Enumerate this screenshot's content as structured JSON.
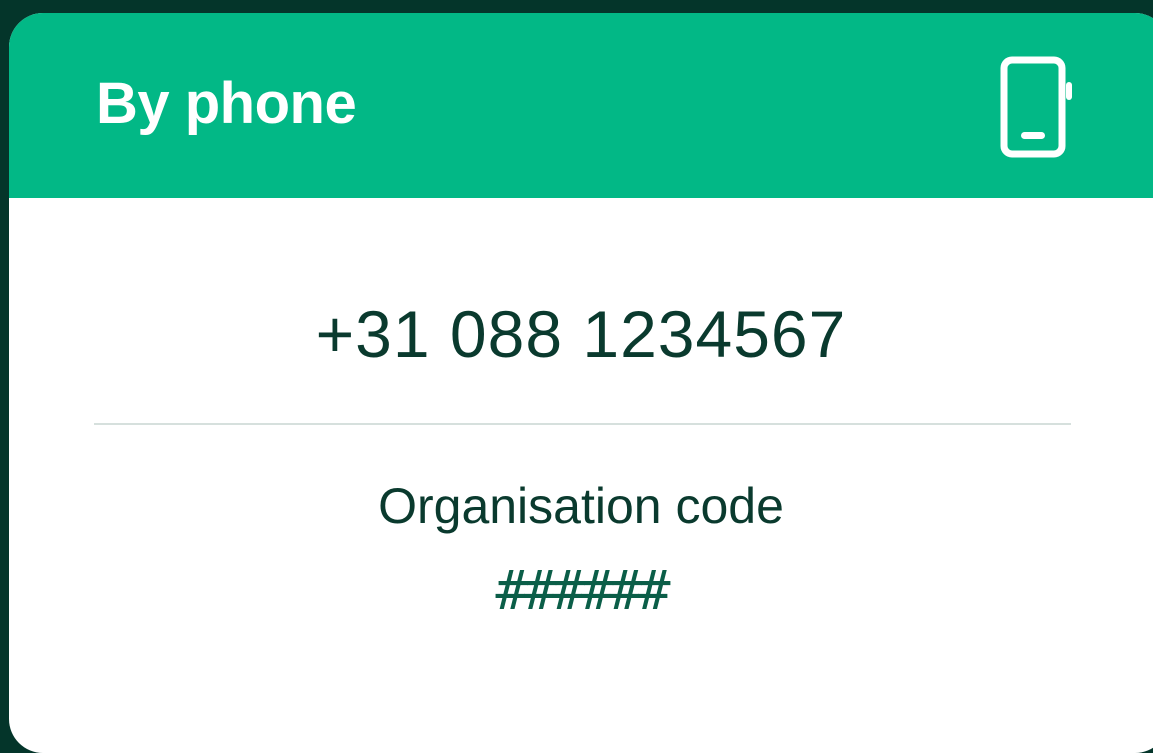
{
  "card": {
    "title": "By phone",
    "icon": "smartphone-icon",
    "phone_number": "+31 088 1234567",
    "organisation_label": "Organisation code",
    "organisation_code": "######"
  },
  "colors": {
    "backdrop": "#04352a",
    "header": "#02b886",
    "text_dark": "#0a3a2e",
    "code_text": "#0b5e48",
    "divider": "#d6e0dd"
  }
}
